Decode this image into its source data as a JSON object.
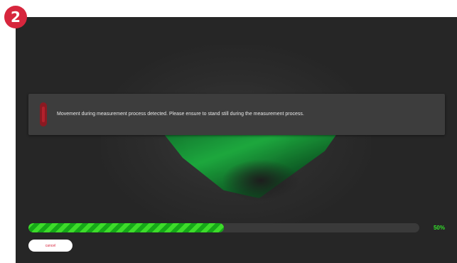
{
  "step_badge": {
    "number": "2",
    "color": "#d7263d"
  },
  "alert": {
    "icon": "warning-bar-icon",
    "message": "Movement during measurement process detected. Please ensure to stand still during the measurement process."
  },
  "progress": {
    "value_percent": 50,
    "label": "50%",
    "fill_colors": [
      "#3ddc2a",
      "#16a818"
    ]
  },
  "actions": {
    "cancel_label": "cancel"
  },
  "colors": {
    "background": "#262626",
    "accent_green": "#33e02a",
    "accent_red": "#d7263d"
  }
}
